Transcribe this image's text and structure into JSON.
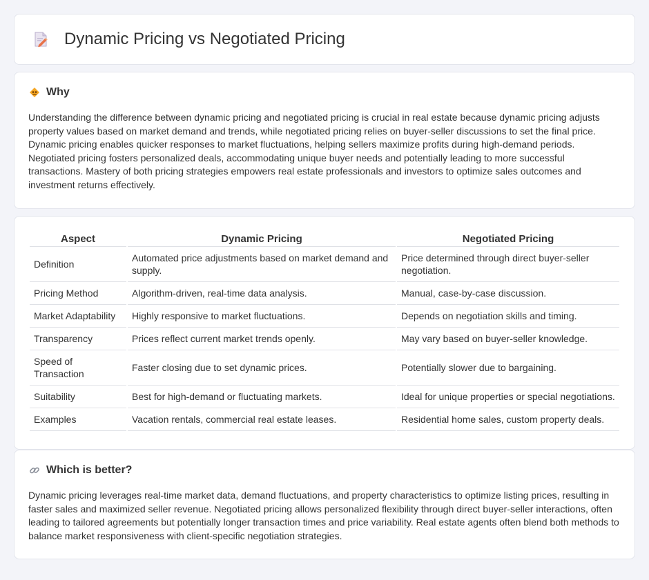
{
  "header": {
    "title": "Dynamic Pricing vs Negotiated Pricing",
    "icon": "document-edit-icon"
  },
  "why": {
    "title": "Why",
    "icon": "diamond-warning-icon",
    "text": "Understanding the difference between dynamic pricing and negotiated pricing is crucial in real estate because dynamic pricing adjusts property values based on market demand and trends, while negotiated pricing relies on buyer-seller discussions to set the final price. Dynamic pricing enables quicker responses to market fluctuations, helping sellers maximize profits during high-demand periods. Negotiated pricing fosters personalized deals, accommodating unique buyer needs and potentially leading to more successful transactions. Mastery of both pricing strategies empowers real estate professionals and investors to optimize sales outcomes and investment returns effectively."
  },
  "table": {
    "headers": [
      "Aspect",
      "Dynamic Pricing",
      "Negotiated Pricing"
    ],
    "rows": [
      [
        "Definition",
        "Automated price adjustments based on market demand and supply.",
        "Price determined through direct buyer-seller negotiation."
      ],
      [
        "Pricing Method",
        "Algorithm-driven, real-time data analysis.",
        "Manual, case-by-case discussion."
      ],
      [
        "Market Adaptability",
        "Highly responsive to market fluctuations.",
        "Depends on negotiation skills and timing."
      ],
      [
        "Transparency",
        "Prices reflect current market trends openly.",
        "May vary based on buyer-seller knowledge."
      ],
      [
        "Speed of Transaction",
        "Faster closing due to set dynamic prices.",
        "Potentially slower due to bargaining."
      ],
      [
        "Suitability",
        "Best for high-demand or fluctuating markets.",
        "Ideal for unique properties or special negotiations."
      ],
      [
        "Examples",
        "Vacation rentals, commercial real estate leases.",
        "Residential home sales, custom property deals."
      ]
    ]
  },
  "better": {
    "title": "Which is better?",
    "icon": "link-icon",
    "text": "Dynamic pricing leverages real-time market data, demand fluctuations, and property characteristics to optimize listing prices, resulting in faster sales and maximized seller revenue. Negotiated pricing allows personalized flexibility through direct buyer-seller interactions, often leading to tailored agreements but potentially longer transaction times and price variability. Real estate agents often blend both methods to balance market responsiveness with client-specific negotiation strategies."
  },
  "colors": {
    "background": "#f3f4f9",
    "card": "#ffffff",
    "border": "#e3e5ec",
    "accent": "#f0a030"
  }
}
